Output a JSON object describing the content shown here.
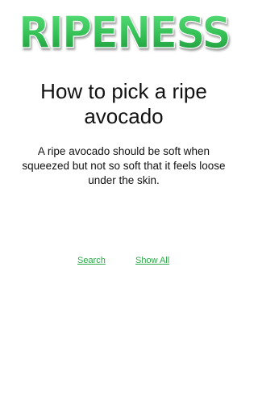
{
  "header": {
    "logo_text": "RIPENESS",
    "brand_color_top": "#4fd671",
    "brand_color_bottom": "#1f9e3e",
    "outline_color": "#ffffff",
    "shadow_color": "#9a9a9a"
  },
  "content": {
    "title": "How to pick a ripe avocado",
    "body": "A ripe avocado should be soft when squeezed but not so soft that it feels loose under the skin."
  },
  "links": {
    "search_label": "Search",
    "show_all_label": "Show All",
    "color": "#2ea84a"
  }
}
